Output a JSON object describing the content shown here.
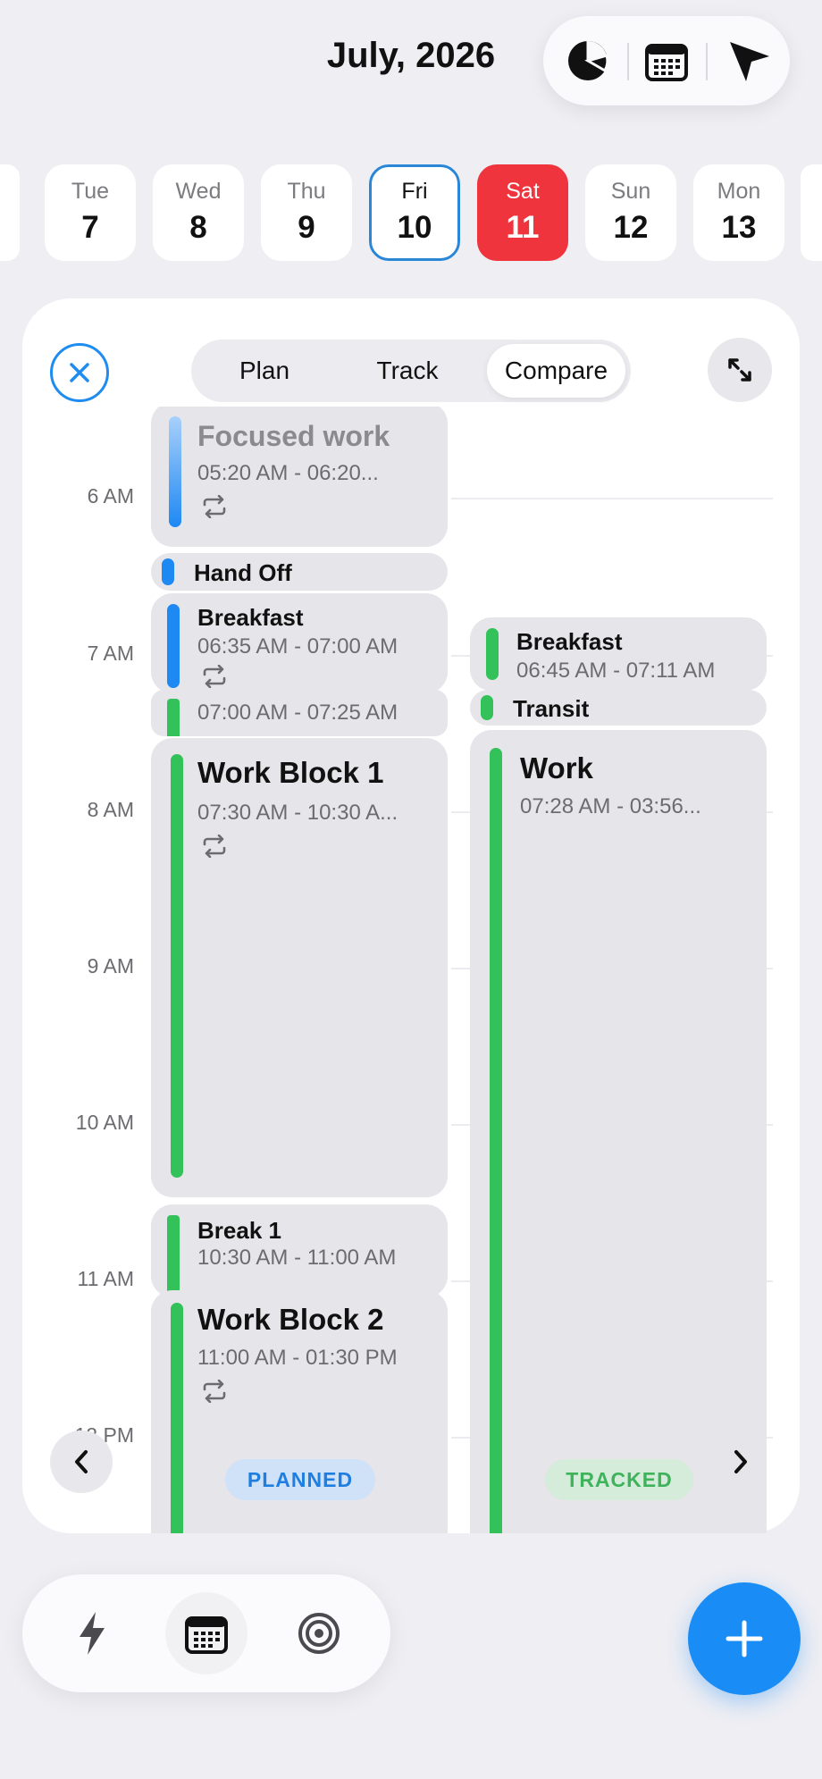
{
  "header": {
    "title": "July, 2026"
  },
  "toolbar": {
    "icons": [
      "pie-chart-icon",
      "calendar-icon",
      "cursor-icon"
    ]
  },
  "days": [
    {
      "name": "Tue",
      "date": "7"
    },
    {
      "name": "Wed",
      "date": "8"
    },
    {
      "name": "Thu",
      "date": "9"
    },
    {
      "name": "Fri",
      "date": "10",
      "state": "selected"
    },
    {
      "name": "Sat",
      "date": "11",
      "state": "today"
    },
    {
      "name": "Sun",
      "date": "12"
    },
    {
      "name": "Mon",
      "date": "13"
    }
  ],
  "segments": {
    "plan": "Plan",
    "track": "Track",
    "compare": "Compare",
    "active": "Compare"
  },
  "time_labels": [
    "6 AM",
    "7 AM",
    "8 AM",
    "9 AM",
    "10 AM",
    "11 AM",
    "12 PM"
  ],
  "planned": {
    "focused": {
      "title": "Focused work",
      "time": "05:20 AM - 06:20..."
    },
    "handoff": {
      "title": "Hand Off"
    },
    "breakfast": {
      "title": "Breakfast",
      "time": "06:35 AM - 07:00 AM"
    },
    "transit": {
      "time": "07:00 AM - 07:25 AM"
    },
    "work1": {
      "title": "Work Block 1",
      "time": "07:30 AM - 10:30 A..."
    },
    "break1": {
      "title": "Break 1",
      "time": "10:30 AM - 11:00 AM"
    },
    "work2": {
      "title": "Work Block 2",
      "time": "11:00 AM - 01:30 PM"
    }
  },
  "tracked": {
    "breakfast": {
      "title": "Breakfast",
      "time": "06:45 AM - 07:11 AM"
    },
    "transit": {
      "title": "Transit"
    },
    "work": {
      "title": "Work",
      "time": "07:28 AM - 03:56..."
    }
  },
  "badges": {
    "planned": "PLANNED",
    "tracked": "TRACKED"
  },
  "colors": {
    "accent": "#1e88f3",
    "green": "#33c15a",
    "today": "#f0343d"
  },
  "bottom_nav": {
    "icons": [
      "bolt-icon",
      "calendar-icon",
      "target-icon"
    ],
    "fab": "plus-icon"
  }
}
